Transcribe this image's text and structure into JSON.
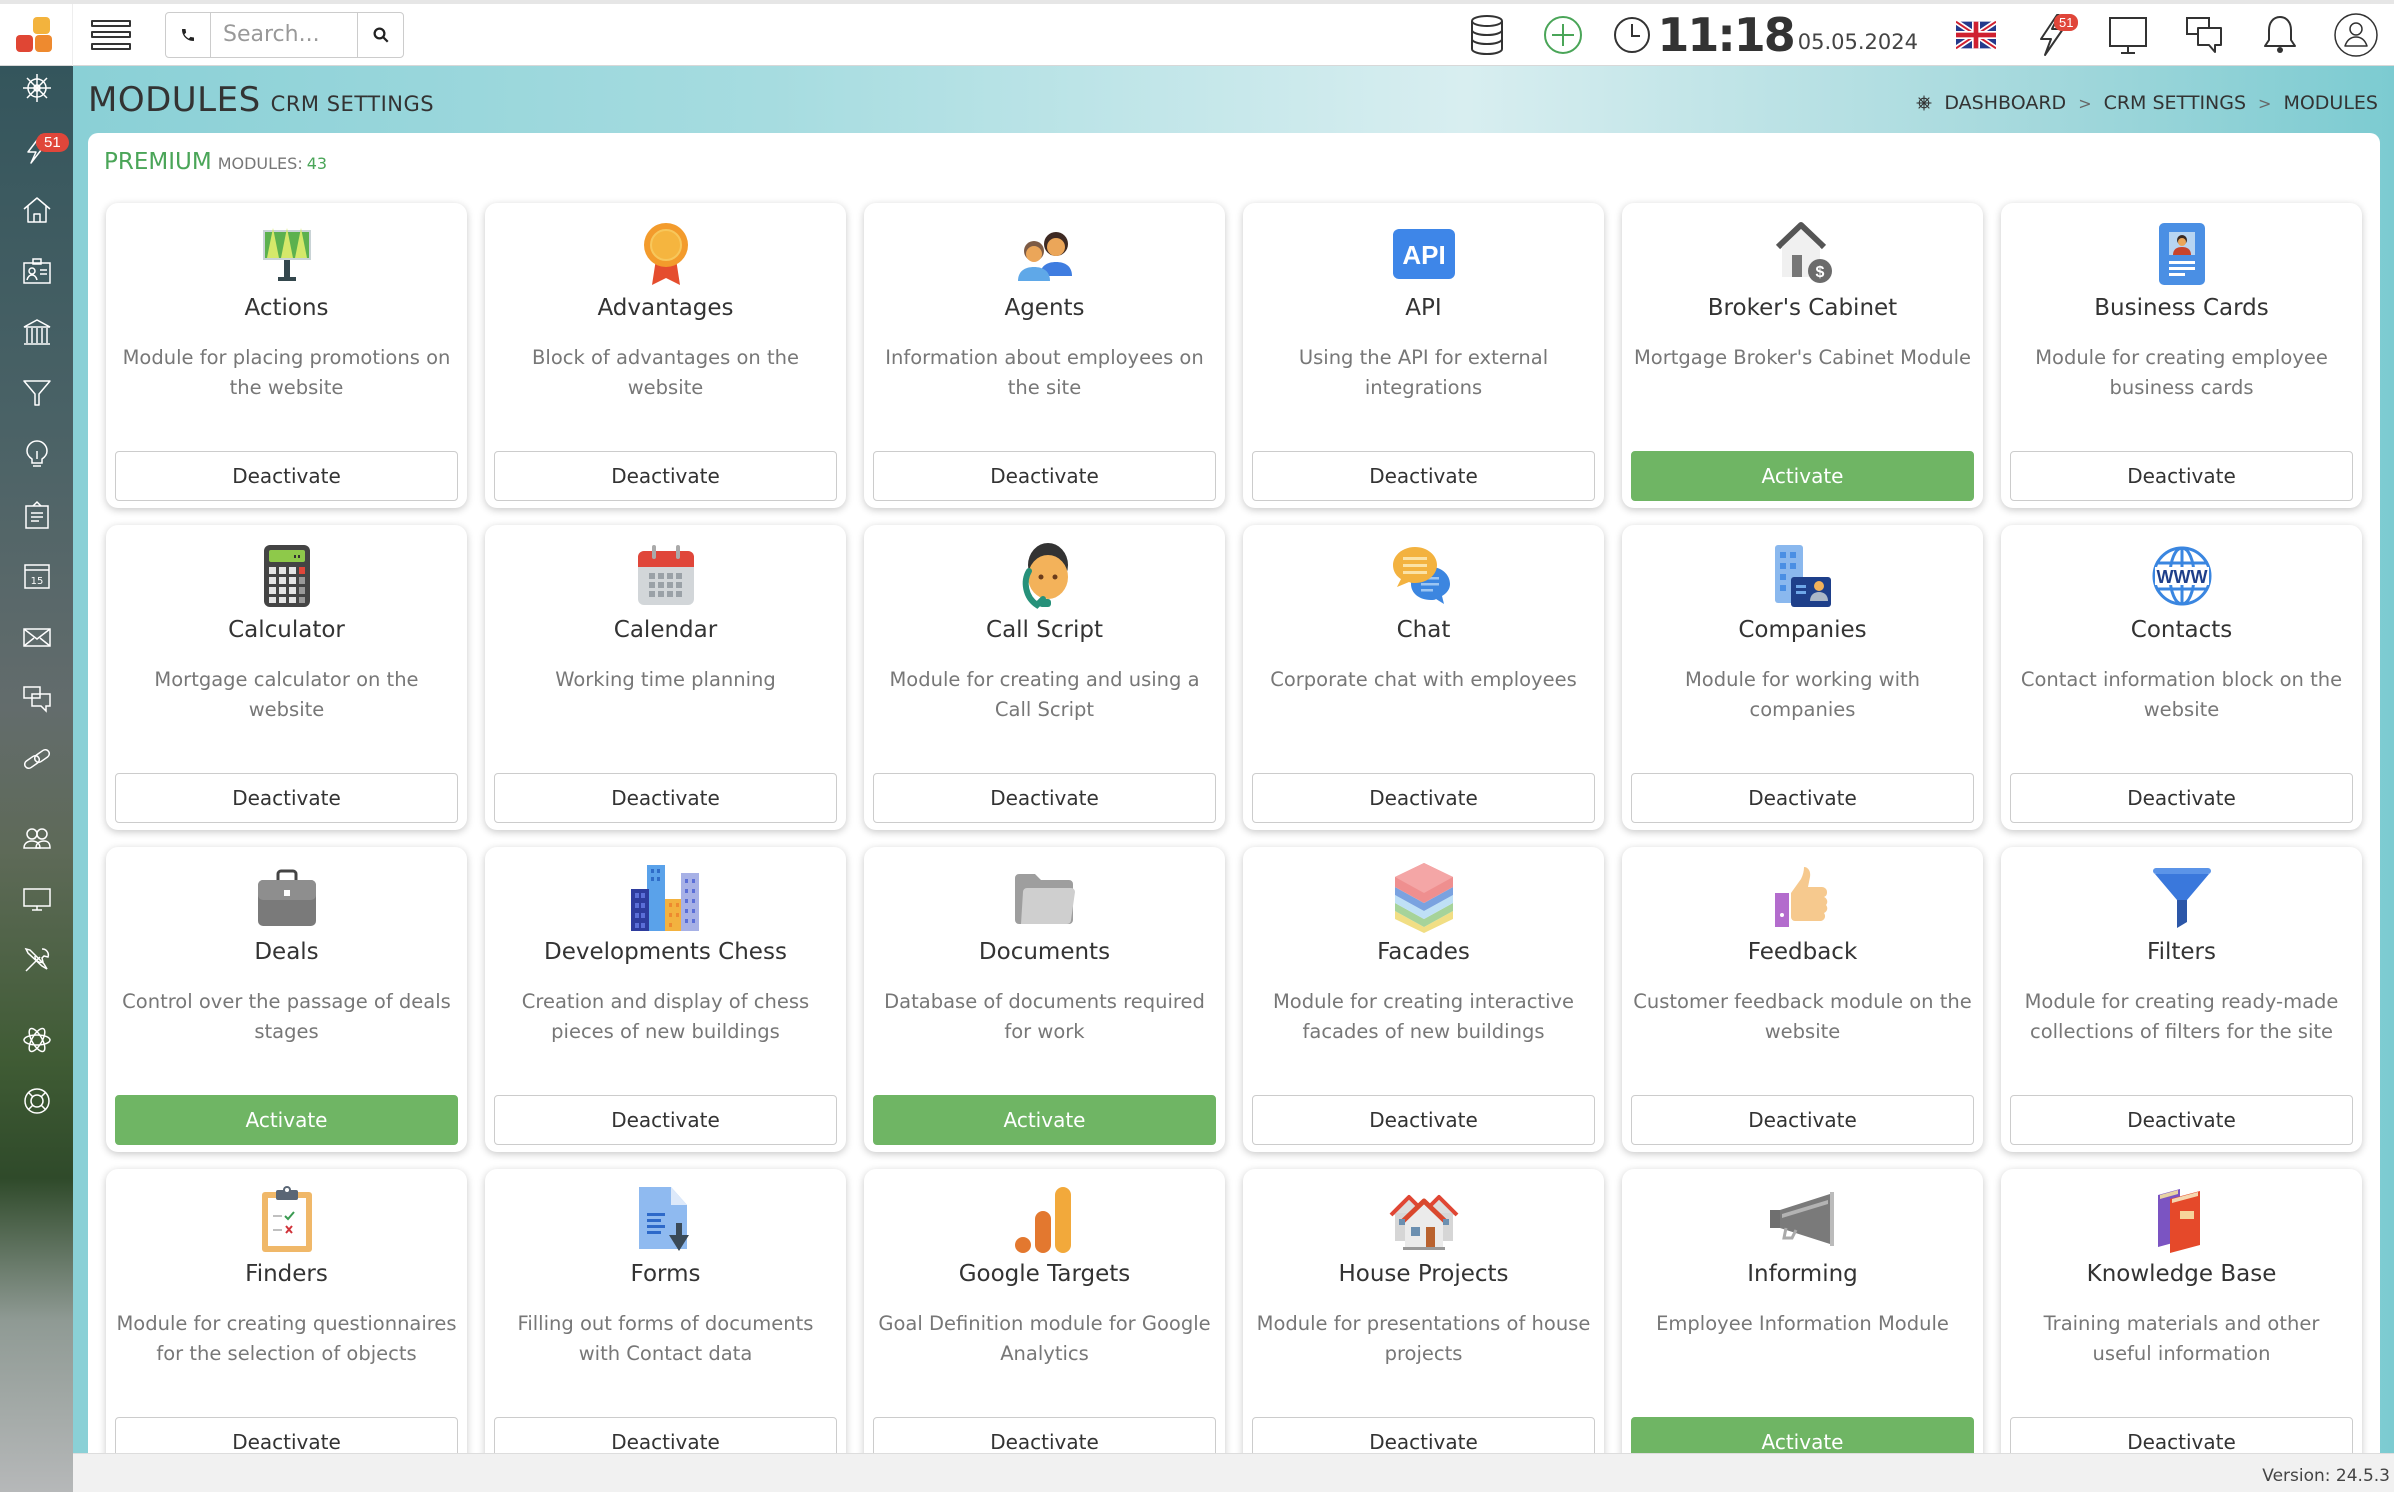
{
  "topbar": {
    "search_placeholder": "Search...",
    "time": "11:18",
    "date": "05.05.2024",
    "notifications_badge": "51"
  },
  "sidebar": {
    "items": [
      {
        "icon": "dashboard-wheel-icon"
      },
      {
        "icon": "lightning-icon",
        "badge": "51"
      },
      {
        "icon": "home-icon"
      },
      {
        "icon": "id-card-icon"
      },
      {
        "icon": "bank-icon"
      },
      {
        "icon": "funnel-icon"
      },
      {
        "icon": "lightbulb-icon"
      },
      {
        "icon": "clipboard-icon"
      },
      {
        "icon": "calendar-icon",
        "label": "15"
      },
      {
        "icon": "mail-icon"
      },
      {
        "icon": "chat-icon"
      },
      {
        "icon": "link-icon"
      },
      {
        "icon": "users-icon"
      },
      {
        "icon": "monitor-icon"
      },
      {
        "icon": "tools-icon"
      },
      {
        "icon": "atom-icon"
      },
      {
        "icon": "lifebuoy-icon"
      }
    ]
  },
  "header": {
    "title": "MODULES",
    "subtitle": "CRM SETTINGS",
    "breadcrumb": [
      "DASHBOARD",
      "CRM SETTINGS",
      "MODULES"
    ],
    "breadcrumb_sep": ">"
  },
  "panel": {
    "plan": "PREMIUM",
    "modules_label": "MODULES:",
    "modules_count": "43"
  },
  "colors": {
    "accent_green": "#6fb564",
    "premium_green": "#4aa558",
    "badge_red": "#e0463a"
  },
  "modules": [
    {
      "name": "Actions",
      "desc": "Module for placing promotions on the website",
      "button": "Deactivate",
      "state": "active",
      "icon": "billboard-icon"
    },
    {
      "name": "Advantages",
      "desc": "Block of advantages on the website",
      "button": "Deactivate",
      "state": "active",
      "icon": "award-icon"
    },
    {
      "name": "Agents",
      "desc": "Information about employees on the site",
      "button": "Deactivate",
      "state": "active",
      "icon": "people-icon"
    },
    {
      "name": "API",
      "desc": "Using the API for external integrations",
      "button": "Deactivate",
      "state": "active",
      "icon": "api-icon"
    },
    {
      "name": "Broker's Cabinet",
      "desc": "Mortgage Broker's Cabinet Module",
      "button": "Activate",
      "state": "inactive",
      "icon": "house-dollar-icon"
    },
    {
      "name": "Business Cards",
      "desc": "Module for creating employee business cards",
      "button": "Deactivate",
      "state": "active",
      "icon": "badge-card-icon"
    },
    {
      "name": "Calculator",
      "desc": "Mortgage calculator on the website",
      "button": "Deactivate",
      "state": "active",
      "icon": "calculator-icon"
    },
    {
      "name": "Calendar",
      "desc": "Working time planning",
      "button": "Deactivate",
      "state": "active",
      "icon": "calendar-icon"
    },
    {
      "name": "Call Script",
      "desc": "Module for creating and using a Call Script",
      "button": "Deactivate",
      "state": "active",
      "icon": "call-agent-icon"
    },
    {
      "name": "Chat",
      "desc": "Corporate chat with employees",
      "button": "Deactivate",
      "state": "active",
      "icon": "chat-bubbles-icon"
    },
    {
      "name": "Companies",
      "desc": "Module for working with companies",
      "button": "Deactivate",
      "state": "active",
      "icon": "company-building-icon"
    },
    {
      "name": "Contacts",
      "desc": "Contact information block on the website",
      "button": "Deactivate",
      "state": "active",
      "icon": "www-globe-icon"
    },
    {
      "name": "Deals",
      "desc": "Control over the passage of deals stages",
      "button": "Activate",
      "state": "inactive",
      "icon": "briefcase-icon"
    },
    {
      "name": "Developments Chess",
      "desc": "Creation and display of chess pieces of new buildings",
      "button": "Deactivate",
      "state": "active",
      "icon": "buildings-icon"
    },
    {
      "name": "Documents",
      "desc": "Database of documents required for work",
      "button": "Activate",
      "state": "inactive",
      "icon": "folder-icon"
    },
    {
      "name": "Facades",
      "desc": "Module for creating interactive facades of new buildings",
      "button": "Deactivate",
      "state": "active",
      "icon": "layers-icon"
    },
    {
      "name": "Feedback",
      "desc": "Customer feedback module on the website",
      "button": "Deactivate",
      "state": "active",
      "icon": "thumbs-up-icon"
    },
    {
      "name": "Filters",
      "desc": "Module for creating ready-made collections of filters for the site",
      "button": "Deactivate",
      "state": "active",
      "icon": "filter-funnel-icon"
    },
    {
      "name": "Finders",
      "desc": "Module for creating questionnaires for the selection of objects",
      "button": "Deactivate",
      "state": "active",
      "icon": "checklist-clipboard-icon"
    },
    {
      "name": "Forms",
      "desc": "Filling out forms of documents with Contact data",
      "button": "Deactivate",
      "state": "active",
      "icon": "document-download-icon"
    },
    {
      "name": "Google Targets",
      "desc": "Goal Definition module for Google Analytics",
      "button": "Deactivate",
      "state": "active",
      "icon": "analytics-bars-icon"
    },
    {
      "name": "House Projects",
      "desc": "Module for presentations of house projects",
      "button": "Deactivate",
      "state": "active",
      "icon": "houses-icon"
    },
    {
      "name": "Informing",
      "desc": "Employee Information Module",
      "button": "Activate",
      "state": "inactive",
      "icon": "megaphone-icon"
    },
    {
      "name": "Knowledge Base",
      "desc": "Training materials and other useful information",
      "button": "Deactivate",
      "state": "active",
      "icon": "books-icon"
    }
  ],
  "footer": {
    "version": "Version: 24.5.3"
  }
}
